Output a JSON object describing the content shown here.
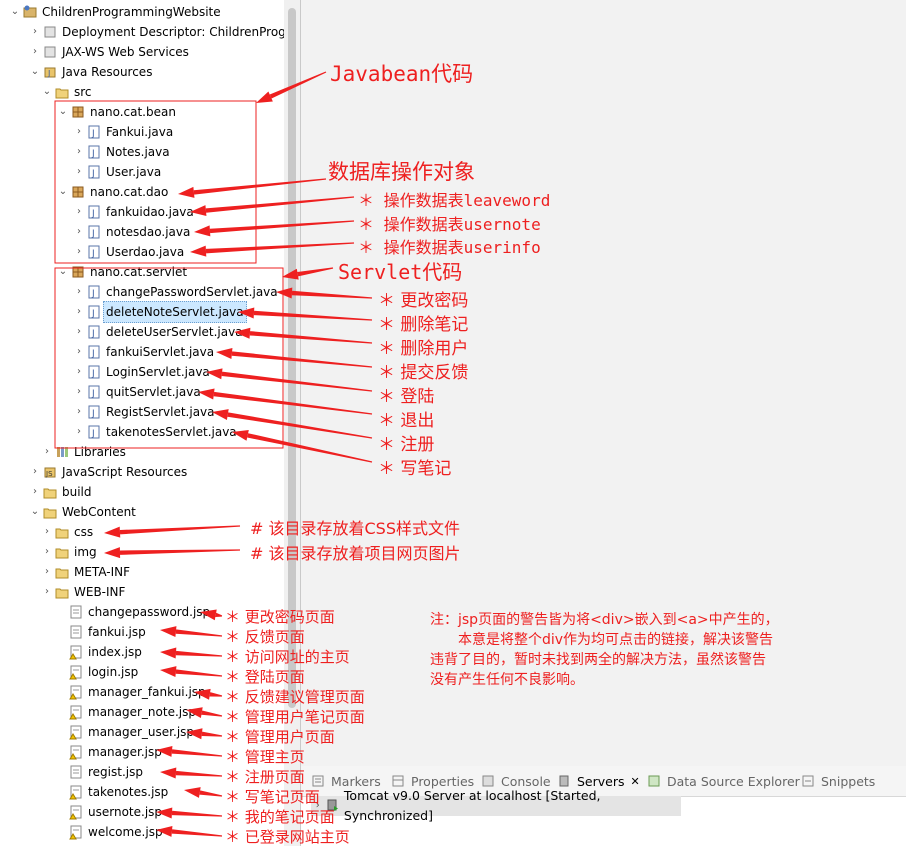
{
  "tree": {
    "project": "ChildrenProgrammingWebsite",
    "items": [
      {
        "label": "Deployment Descriptor: ChildrenProgr",
        "icon": "deployment-descriptor-icon"
      },
      {
        "label": "JAX-WS Web Services",
        "icon": "web-services-icon"
      },
      {
        "label": "Java Resources",
        "icon": "java-resources-icon"
      },
      {
        "label": "src",
        "icon": "source-folder-icon"
      },
      {
        "label": "nano.cat.bean",
        "icon": "package-icon"
      },
      {
        "label": "Fankui.java",
        "icon": "java-file-icon"
      },
      {
        "label": "Notes.java",
        "icon": "java-file-icon"
      },
      {
        "label": "User.java",
        "icon": "java-file-icon"
      },
      {
        "label": "nano.cat.dao",
        "icon": "package-icon"
      },
      {
        "label": "fankuidao.java",
        "icon": "java-file-icon"
      },
      {
        "label": "notesdao.java",
        "icon": "java-file-icon"
      },
      {
        "label": "Userdao.java",
        "icon": "java-file-icon"
      },
      {
        "label": "nano.cat.servlet",
        "icon": "package-icon"
      },
      {
        "label": "changePasswordServlet.java",
        "icon": "java-file-icon"
      },
      {
        "label": "deleteNoteServlet.java",
        "icon": "java-file-icon"
      },
      {
        "label": "deleteUserServlet.java",
        "icon": "java-file-icon"
      },
      {
        "label": "fankuiServlet.java",
        "icon": "java-file-icon"
      },
      {
        "label": "LoginServlet.java",
        "icon": "java-file-icon"
      },
      {
        "label": "quitServlet.java",
        "icon": "java-file-icon"
      },
      {
        "label": "RegistServlet.java",
        "icon": "java-file-icon"
      },
      {
        "label": "takenotesServlet.java",
        "icon": "java-file-icon"
      },
      {
        "label": "Libraries",
        "icon": "libraries-icon"
      },
      {
        "label": "JavaScript Resources",
        "icon": "javascript-resources-icon"
      },
      {
        "label": "build",
        "icon": "folder-icon"
      },
      {
        "label": "WebContent",
        "icon": "folder-icon"
      },
      {
        "label": "css",
        "icon": "folder-icon"
      },
      {
        "label": "img",
        "icon": "folder-icon"
      },
      {
        "label": "META-INF",
        "icon": "folder-icon"
      },
      {
        "label": "WEB-INF",
        "icon": "folder-icon"
      },
      {
        "label": "changepassword.jsp",
        "icon": "jsp-file-icon"
      },
      {
        "label": "fankui.jsp",
        "icon": "jsp-file-icon"
      },
      {
        "label": "index.jsp",
        "icon": "jsp-warning-file-icon"
      },
      {
        "label": "login.jsp",
        "icon": "jsp-warning-file-icon"
      },
      {
        "label": "manager_fankui.jsp",
        "icon": "jsp-warning-file-icon"
      },
      {
        "label": "manager_note.jsp",
        "icon": "jsp-warning-file-icon"
      },
      {
        "label": "manager_user.jsp",
        "icon": "jsp-warning-file-icon"
      },
      {
        "label": "manager.jsp",
        "icon": "jsp-warning-file-icon"
      },
      {
        "label": "regist.jsp",
        "icon": "jsp-file-icon"
      },
      {
        "label": "takenotes.jsp",
        "icon": "jsp-warning-file-icon"
      },
      {
        "label": "usernote.jsp",
        "icon": "jsp-warning-file-icon"
      },
      {
        "label": "welcome.jsp",
        "icon": "jsp-warning-file-icon"
      }
    ]
  },
  "annotations": {
    "javabean": "Javabean代码",
    "dao": "数据库操作对象",
    "dao_items": [
      "＊ 操作数据表leaveword",
      "＊ 操作数据表usernote",
      "＊ 操作数据表userinfo"
    ],
    "servlet": "Servlet代码",
    "servlet_items": [
      "＊ 更改密码",
      "＊ 删除笔记",
      "＊ 删除用户",
      "＊ 提交反馈",
      "＊ 登陆",
      "＊ 退出",
      "＊ 注册",
      "＊ 写笔记"
    ],
    "folder_items": [
      "# 该目录存放着CSS样式文件",
      "# 该目录存放着项目网页图片"
    ],
    "jsp_items": [
      "＊ 更改密码页面",
      "＊ 反馈页面",
      "＊ 访问网址的主页",
      "＊ 登陆页面",
      "＊ 反馈建议管理页面",
      "＊ 管理用户笔记页面",
      "＊ 管理用户页面",
      "＊ 管理主页",
      "＊ 注册页面",
      "＊ 写笔记页面",
      "＊ 我的笔记页面",
      "＊ 已登录网站主页"
    ],
    "note_lines": [
      "注：jsp页面的警告皆为将<div>嵌入到<a>中产生的，",
      "本意是将整个div作为均可点击的链接，解决该警告",
      "违背了目的，暂时未找到两全的解决方法，虽然该警告",
      "没有产生任何不良影响。"
    ]
  },
  "servers_view": {
    "tabs": [
      "Markers",
      "Properties",
      "Console",
      "Servers",
      "Data Source Explorer",
      "Snippets"
    ],
    "active_tab": "Servers",
    "server_entry": "Tomcat v9.0 Server at localhost  [Started, Synchronized]"
  },
  "colors": {
    "annotation": "#ee2020",
    "selection": "#cce8ff",
    "panel": "#f2f2f2"
  }
}
